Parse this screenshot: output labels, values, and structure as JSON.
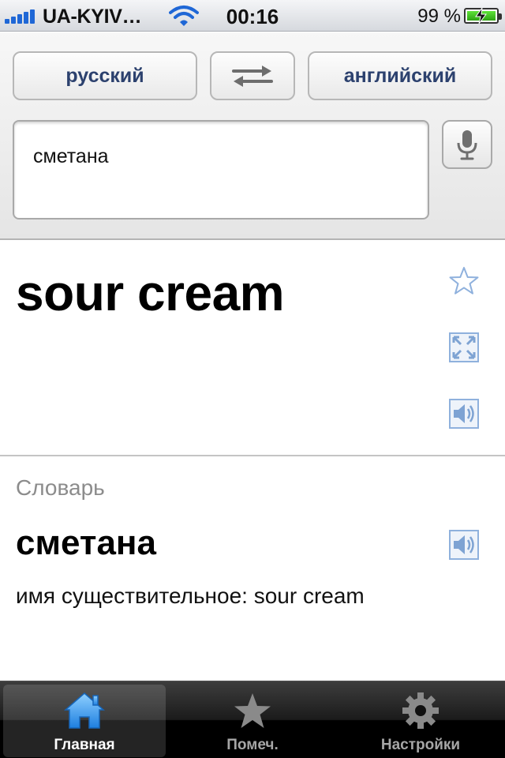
{
  "status_bar": {
    "carrier": "UA-KYIV…",
    "time": "00:16",
    "battery_percent": "99 %",
    "battery_level": 0.99,
    "signal_bars": 5
  },
  "controls": {
    "source_language": "русский",
    "target_language": "английский",
    "swap_icon": "swap-arrows-icon",
    "input_text": "сметана",
    "mic_icon": "microphone-icon"
  },
  "result": {
    "translation": "sour cream",
    "actions": [
      "star-icon",
      "fullscreen-icon",
      "speaker-icon"
    ]
  },
  "dictionary": {
    "header": "Словарь",
    "word": "сметана",
    "definition": "имя существительное: sour cream",
    "speaker_icon": "speaker-icon"
  },
  "tab_bar": {
    "tabs": [
      {
        "label": "Главная",
        "icon": "home-icon",
        "active": true
      },
      {
        "label": "Помеч.",
        "icon": "star-icon",
        "active": false
      },
      {
        "label": "Настройки",
        "icon": "gear-icon",
        "active": false
      }
    ]
  },
  "colors": {
    "accent_blue": "#2c416e",
    "icon_blue": "#8fb1dd",
    "tab_active_icon": "#3f9bf0"
  }
}
